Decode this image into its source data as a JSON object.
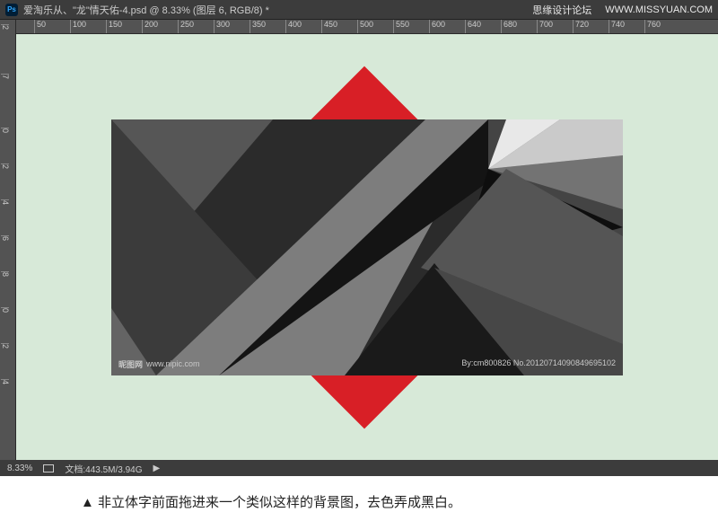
{
  "titlebar": {
    "ps": "Ps",
    "title": "爱淘乐从、\"龙\"情天佑-4.psd @ 8.33% (图层 6, RGB/8) *"
  },
  "watermark": {
    "forum": "思缘设计论坛",
    "url": "WWW.MISSYUAN.COM"
  },
  "ruler_h": [
    {
      "pos": 20,
      "label": "50"
    },
    {
      "pos": 60,
      "label": "100"
    },
    {
      "pos": 100,
      "label": "150"
    },
    {
      "pos": 140,
      "label": "200"
    },
    {
      "pos": 180,
      "label": "250"
    },
    {
      "pos": 220,
      "label": "300"
    },
    {
      "pos": 260,
      "label": "350"
    },
    {
      "pos": 300,
      "label": "400"
    },
    {
      "pos": 340,
      "label": "450"
    },
    {
      "pos": 380,
      "label": "500"
    },
    {
      "pos": 420,
      "label": "550"
    },
    {
      "pos": 460,
      "label": "600"
    },
    {
      "pos": 500,
      "label": "640"
    },
    {
      "pos": 540,
      "label": "680"
    },
    {
      "pos": 580,
      "label": "700"
    },
    {
      "pos": 620,
      "label": "720"
    },
    {
      "pos": 660,
      "label": "740"
    },
    {
      "pos": 700,
      "label": "760"
    }
  ],
  "ruler_v": [
    {
      "pos": 5,
      "label": "2"
    },
    {
      "pos": 60,
      "label": "7"
    },
    {
      "pos": 120,
      "label": "0"
    },
    {
      "pos": 160,
      "label": "2"
    },
    {
      "pos": 200,
      "label": "4"
    },
    {
      "pos": 240,
      "label": "6"
    },
    {
      "pos": 280,
      "label": "8"
    },
    {
      "pos": 320,
      "label": "0"
    },
    {
      "pos": 360,
      "label": "2"
    },
    {
      "pos": 400,
      "label": "4"
    }
  ],
  "artwork_footer": {
    "left_logo": "昵图网",
    "left_url": "www.nipic.com",
    "right": "By:cm800826   No.20120714090849695102"
  },
  "status": {
    "zoom": "8.33%",
    "doc": "文档:443.5M/3.94G",
    "arrow": "▶"
  },
  "caption": "▲ 非立体字前面拖进来一个类似这样的背景图，去色弄成黑白。"
}
